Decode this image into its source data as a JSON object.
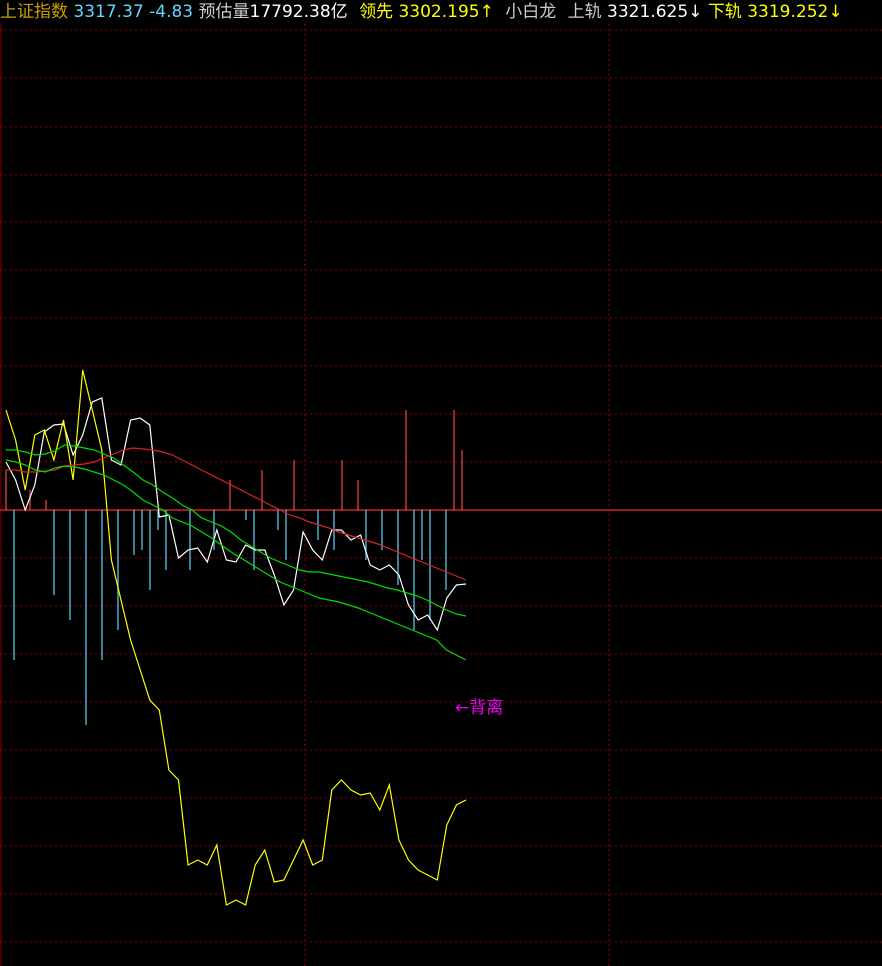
{
  "header": {
    "index_name": "上证指数",
    "index_value": "3317.37",
    "index_change": "-4.83",
    "volume_label": "预估量",
    "volume_value": "17792.38亿",
    "lead_label": "领先",
    "lead_value": "3302.195↑",
    "indicator_name": "小白龙",
    "upper_label": "上轨",
    "upper_value": "3321.625↓",
    "lower_label": "下轨",
    "lower_value": "3319.252↓"
  },
  "annotation": "←背离",
  "colors": {
    "background": "#000000",
    "grid": "#8b0000",
    "index_name": "#c8a000",
    "index_value": "#5fd7ff",
    "label": "#cccccc",
    "label_value": "#ffffff",
    "lead": "#ffff00",
    "lower": "#ffff00",
    "white_line": "#ffffff",
    "yellow_line": "#ffff00",
    "upper_band": "#00dd00",
    "lower_band": "#00dd00",
    "middle_line": "#dd2222",
    "bar_up": "#dd4444",
    "bar_down": "#55c8e8",
    "annotation": "#ee00ee"
  },
  "chart_data": {
    "type": "line",
    "x": [
      0,
      1,
      2,
      3,
      4,
      5,
      6,
      7,
      8,
      9,
      10,
      11,
      12,
      13,
      14,
      15,
      16,
      17,
      18,
      19,
      20,
      21,
      22,
      23,
      24,
      25,
      26,
      27,
      28,
      29,
      30,
      31,
      32,
      33,
      34,
      35,
      36,
      37,
      38,
      39,
      40,
      41,
      42,
      43,
      44,
      45,
      46
    ],
    "ylim": [
      -210,
      120
    ],
    "series": [
      {
        "id": "white",
        "color": "#ffffff",
        "values": [
          48,
          30,
          0,
          25,
          78,
          85,
          86,
          55,
          75,
          108,
          112,
          50,
          45,
          90,
          92,
          85,
          -7,
          -5,
          -48,
          -40,
          -38,
          -52,
          -20,
          -50,
          -52,
          -35,
          -40,
          -40,
          -65,
          -95,
          -80,
          -22,
          -40,
          -50,
          -20,
          -20,
          -30,
          -25,
          -55,
          -60,
          -55,
          -65,
          -95,
          -110,
          -105,
          -120,
          -88,
          -75,
          -74
        ]
      },
      {
        "id": "yellow",
        "color": "#ffff00",
        "values": [
          100,
          70,
          20,
          75,
          80,
          50,
          90,
          30,
          140,
          100,
          60,
          -50,
          -90,
          -130,
          -160,
          -190,
          -200,
          -260,
          -270,
          -355,
          -350,
          -355,
          -335,
          -395,
          -390,
          -395,
          -355,
          -340,
          -372,
          -370,
          -350,
          -330,
          -355,
          -350,
          -280,
          -270,
          -280,
          -285,
          -283,
          -300,
          -275,
          -330,
          -350,
          -360,
          -365,
          -370,
          -315,
          -295,
          -290
        ]
      },
      {
        "id": "green_upper",
        "color": "#00dd00",
        "values": [
          60,
          60,
          58,
          55,
          56,
          59,
          65,
          64,
          62,
          60,
          56,
          52,
          45,
          38,
          30,
          25,
          18,
          12,
          5,
          0,
          -8,
          -12,
          -16,
          -22,
          -30,
          -36,
          -42,
          -48,
          -52,
          -56,
          -60,
          -62,
          -62,
          -64,
          -66,
          -68,
          -70,
          -72,
          -75,
          -78,
          -80,
          -83,
          -86,
          -90,
          -95,
          -100,
          -104,
          -106
        ]
      },
      {
        "id": "red_mid",
        "color": "#dd2222",
        "values": [
          40,
          40,
          38,
          38,
          39,
          40,
          44,
          45,
          46,
          48,
          52,
          56,
          60,
          62,
          61,
          60,
          58,
          55,
          50,
          45,
          40,
          35,
          30,
          25,
          20,
          15,
          10,
          5,
          0,
          -5,
          -8,
          -12,
          -15,
          -18,
          -22,
          -25,
          -28,
          -31,
          -34,
          -38,
          -42,
          -46,
          -50,
          -54,
          -58,
          -62,
          -66,
          -70
        ]
      },
      {
        "id": "green_lower",
        "color": "#00dd00",
        "values": [
          50,
          48,
          45,
          40,
          38,
          42,
          44,
          43,
          41,
          38,
          35,
          30,
          25,
          18,
          10,
          5,
          0,
          -8,
          -12,
          -16,
          -22,
          -28,
          -35,
          -42,
          -48,
          -54,
          -60,
          -66,
          -72,
          -76,
          -80,
          -84,
          -88,
          -90,
          -92,
          -95,
          -98,
          -102,
          -106,
          -110,
          -114,
          -118,
          -122,
          -126,
          -130,
          -140,
          -145,
          -150
        ]
      }
    ],
    "bars": [
      40,
      -150,
      0,
      20,
      0,
      10,
      -85,
      0,
      -110,
      0,
      -215,
      0,
      -150,
      0,
      -120,
      0,
      -45,
      -40,
      -80,
      -20,
      -60,
      0,
      0,
      -60,
      0,
      0,
      -40,
      0,
      30,
      0,
      -10,
      -60,
      40,
      0,
      -20,
      -50,
      50,
      0,
      0,
      -30,
      0,
      -40,
      50,
      0,
      30,
      -50,
      0,
      -40,
      0,
      -75,
      100,
      -120,
      -50,
      -110,
      0,
      -80,
      100,
      60
    ]
  }
}
